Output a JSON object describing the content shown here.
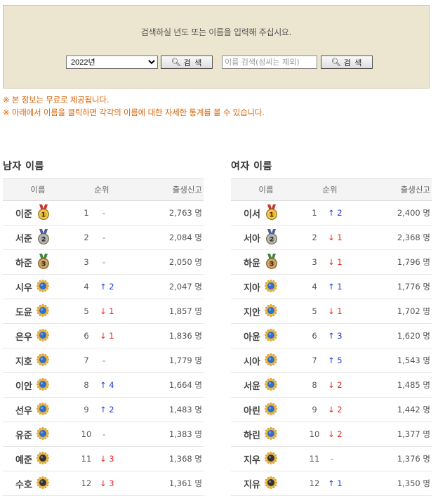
{
  "search": {
    "prompt": "검색하실 년도 또는 이름을 입력해 주십시요.",
    "year_selected": "2022년",
    "year_button": "검 색",
    "name_placeholder": "이름 검색(성씨는 제외)",
    "name_button": "검 색"
  },
  "notices": [
    "※ 본 정보는 무료로 제공됩니다.",
    "※ 아래에서 이름을 클릭하면 각각의 이름에 대한 자세한 통계를 볼 수 있습니다."
  ],
  "colors": {
    "search_bg": "#ece5cf",
    "notice": "#d8660c",
    "up": "#1f3bd6",
    "down": "#e1261c",
    "gold": "#e8b51e",
    "silver": "#9aa3ad",
    "bronze": "#b98a4a",
    "blue_badge": "#2f6fc8",
    "dark_badge": "#333333"
  },
  "boys": {
    "title": "남자 이름",
    "headers": {
      "name": "이름",
      "rank": "순위",
      "count": "출생신고"
    },
    "rows": [
      {
        "name": "이준",
        "rank": "1",
        "change": "-",
        "dir": "same",
        "count": "2,763 명",
        "badge": "gold",
        "badge_num": "1"
      },
      {
        "name": "서준",
        "rank": "2",
        "change": "-",
        "dir": "same",
        "count": "2,084 명",
        "badge": "silver",
        "badge_num": "2"
      },
      {
        "name": "하준",
        "rank": "3",
        "change": "-",
        "dir": "same",
        "count": "2,050 명",
        "badge": "bronze",
        "badge_num": "3"
      },
      {
        "name": "시우",
        "rank": "4",
        "change": "↑ 2",
        "dir": "up",
        "count": "2,047 명",
        "badge": "blue",
        "badge_num": ""
      },
      {
        "name": "도윤",
        "rank": "5",
        "change": "↓ 1",
        "dir": "down",
        "count": "1,857 명",
        "badge": "blue",
        "badge_num": ""
      },
      {
        "name": "은우",
        "rank": "6",
        "change": "↓ 1",
        "dir": "down",
        "count": "1,836 명",
        "badge": "blue",
        "badge_num": ""
      },
      {
        "name": "지호",
        "rank": "7",
        "change": "-",
        "dir": "same",
        "count": "1,779 명",
        "badge": "blue",
        "badge_num": ""
      },
      {
        "name": "이안",
        "rank": "8",
        "change": "↑ 4",
        "dir": "up",
        "count": "1,664 명",
        "badge": "blue",
        "badge_num": ""
      },
      {
        "name": "선우",
        "rank": "9",
        "change": "↑ 2",
        "dir": "up",
        "count": "1,483 명",
        "badge": "blue",
        "badge_num": ""
      },
      {
        "name": "유준",
        "rank": "10",
        "change": "-",
        "dir": "same",
        "count": "1,383 명",
        "badge": "blue",
        "badge_num": ""
      },
      {
        "name": "예준",
        "rank": "11",
        "change": "↓ 3",
        "dir": "down",
        "count": "1,368 명",
        "badge": "dark",
        "badge_num": ""
      },
      {
        "name": "수호",
        "rank": "12",
        "change": "↓ 3",
        "dir": "down",
        "count": "1,361 명",
        "badge": "dark",
        "badge_num": ""
      }
    ]
  },
  "girls": {
    "title": "여자 이름",
    "headers": {
      "name": "이름",
      "rank": "순위",
      "count": "출생신고"
    },
    "rows": [
      {
        "name": "이서",
        "rank": "1",
        "change": "↑ 2",
        "dir": "up",
        "count": "2,400 명",
        "badge": "gold",
        "badge_num": "1"
      },
      {
        "name": "서아",
        "rank": "2",
        "change": "↓ 1",
        "dir": "down",
        "count": "2,368 명",
        "badge": "silver",
        "badge_num": "2"
      },
      {
        "name": "하윤",
        "rank": "3",
        "change": "↓ 1",
        "dir": "down",
        "count": "1,796 명",
        "badge": "bronze",
        "badge_num": "3"
      },
      {
        "name": "지아",
        "rank": "4",
        "change": "↑ 1",
        "dir": "up",
        "count": "1,776 명",
        "badge": "blue",
        "badge_num": ""
      },
      {
        "name": "지안",
        "rank": "5",
        "change": "↓ 1",
        "dir": "down",
        "count": "1,702 명",
        "badge": "blue",
        "badge_num": ""
      },
      {
        "name": "아윤",
        "rank": "6",
        "change": "↑ 3",
        "dir": "up",
        "count": "1,620 명",
        "badge": "blue",
        "badge_num": ""
      },
      {
        "name": "시아",
        "rank": "7",
        "change": "↑ 5",
        "dir": "up",
        "count": "1,543 명",
        "badge": "blue",
        "badge_num": ""
      },
      {
        "name": "서윤",
        "rank": "8",
        "change": "↓ 2",
        "dir": "down",
        "count": "1,485 명",
        "badge": "blue",
        "badge_num": ""
      },
      {
        "name": "아린",
        "rank": "9",
        "change": "↓ 2",
        "dir": "down",
        "count": "1,442 명",
        "badge": "blue",
        "badge_num": ""
      },
      {
        "name": "하린",
        "rank": "10",
        "change": "↓ 2",
        "dir": "down",
        "count": "1,377 명",
        "badge": "blue",
        "badge_num": ""
      },
      {
        "name": "지우",
        "rank": "11",
        "change": "-",
        "dir": "same",
        "count": "1,376 명",
        "badge": "dark",
        "badge_num": ""
      },
      {
        "name": "지유",
        "rank": "12",
        "change": "↑ 1",
        "dir": "up",
        "count": "1,350 명",
        "badge": "dark",
        "badge_num": ""
      }
    ]
  }
}
